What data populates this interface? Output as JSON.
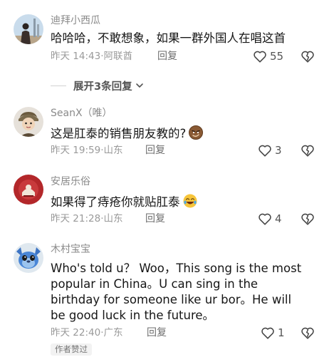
{
  "comments": [
    {
      "username": "迪拜小西瓜",
      "text": "哈哈哈，不敢想象，如果一群外国人在唱这首",
      "time": "昨天 14:43",
      "location": "阿联酋",
      "reply_label": "回复",
      "likes": "55"
    },
    {
      "username": "SeanX（唯）",
      "text": "这是肛泰的销售朋友教的?",
      "time": "昨天 19:59",
      "location": "山东",
      "reply_label": "回复",
      "likes": "3"
    },
    {
      "username": "安居乐俗",
      "text": "如果得了痔疮你就贴肛泰",
      "time": "昨天 21:28",
      "location": "山东",
      "reply_label": "回复",
      "likes": "4"
    },
    {
      "username": "木村宝宝",
      "text": "Who's told u？ Woo，This song is the most popular in China。U can sing in the birthday for someone like ur bor。He will be good luck in the future。",
      "time": "昨天 22:40",
      "location": "广东",
      "reply_label": "回复",
      "likes": "1",
      "badge": "作者赞过"
    }
  ],
  "expand_replies_label": "展开3条回复",
  "meta_separator": "·",
  "icons": {
    "like": "heart-outline-icon",
    "dislike": "broken-heart-icon",
    "expand": "chevron-down-icon"
  }
}
